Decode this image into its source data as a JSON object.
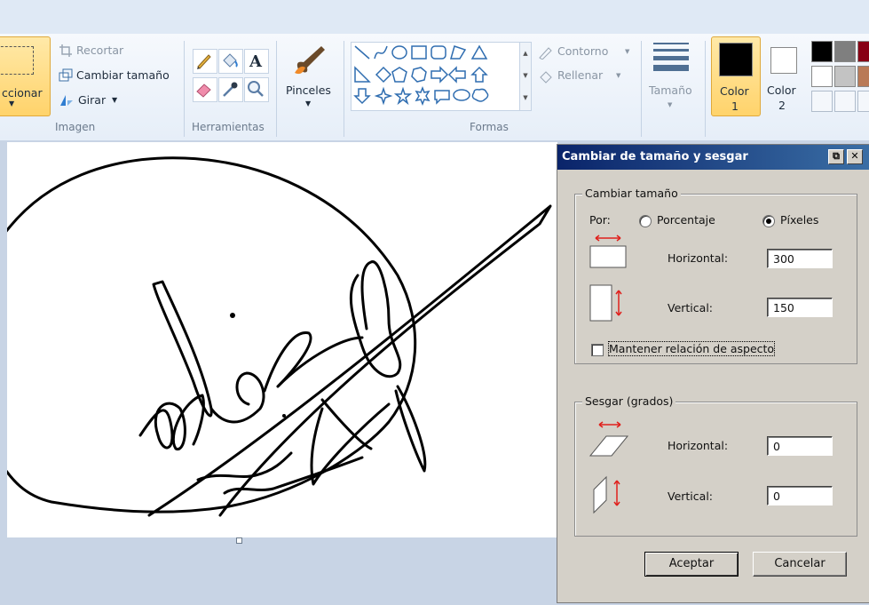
{
  "ribbon": {
    "imagen": {
      "select_label": "ccionar",
      "crop": "Recortar",
      "resize": "Cambiar tamaño",
      "rotate": "Girar",
      "group_label": "Imagen"
    },
    "herramientas": {
      "group_label": "Herramientas"
    },
    "pinceles": {
      "label": "Pinceles"
    },
    "formas": {
      "outline": "Contorno",
      "fill": "Rellenar",
      "group_label": "Formas"
    },
    "tamano": {
      "label": "Tamaño"
    },
    "color1": {
      "line1": "Color",
      "line2": "1",
      "value": "#000000"
    },
    "color2": {
      "line1": "Color",
      "line2": "2",
      "value": "#ffffff"
    },
    "palette": [
      "#000000",
      "#7f7f7f",
      "#880015",
      "#ffffff",
      "#c3c3c3",
      "#b97a57"
    ]
  },
  "dialog": {
    "title": "Cambiar de tamaño y sesgar",
    "resize_section": {
      "legend": "Cambiar tamaño",
      "by_label": "Por:",
      "option_percent": "Porcentaje",
      "option_pixels": "Píxeles",
      "selected": "Píxeles",
      "horizontal_label": "Horizontal:",
      "horizontal_value": "300",
      "vertical_label": "Vertical:",
      "vertical_value": "150",
      "keep_ratio_label": "Mantener relación de aspecto",
      "keep_ratio_checked": false
    },
    "skew_section": {
      "legend": "Sesgar (grados)",
      "horizontal_label": "Horizontal:",
      "horizontal_value": "0",
      "vertical_label": "Vertical:",
      "vertical_value": "0"
    },
    "ok_label": "Aceptar",
    "cancel_label": "Cancelar"
  }
}
